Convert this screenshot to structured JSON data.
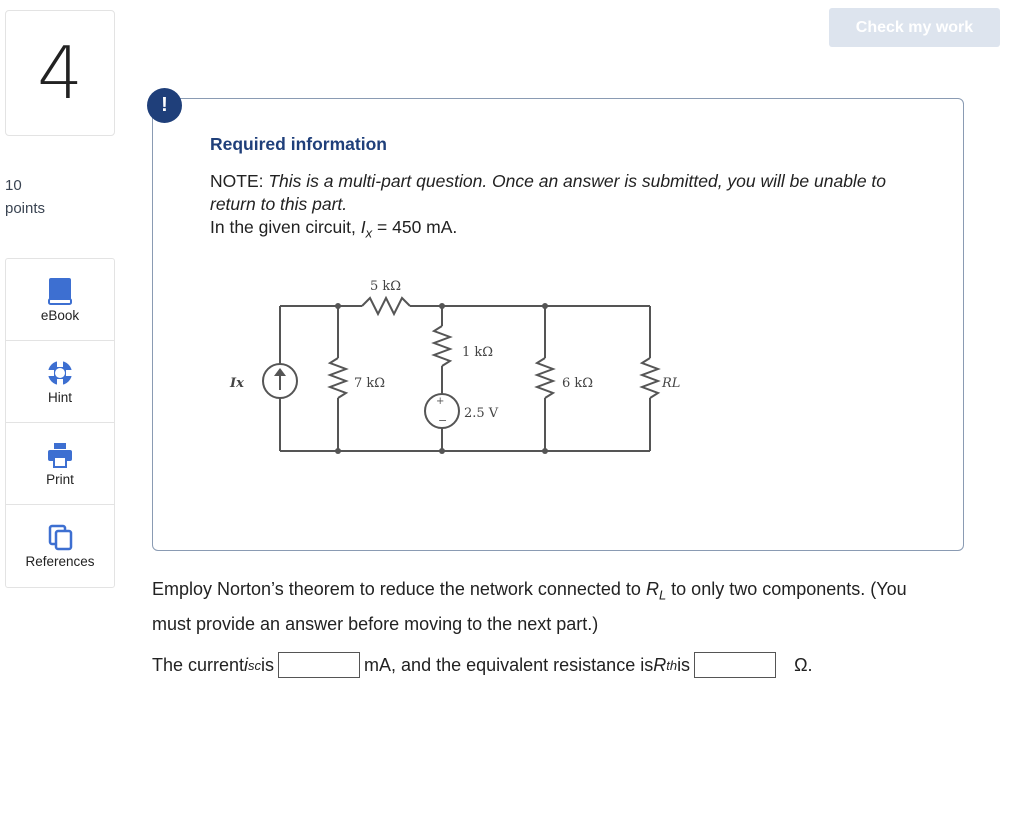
{
  "question": {
    "number": "4",
    "points_value": "10",
    "points_label": "points"
  },
  "tools": [
    {
      "label": "eBook",
      "icon": "book-icon"
    },
    {
      "label": "Hint",
      "icon": "lifebuoy-icon"
    },
    {
      "label": "Print",
      "icon": "printer-icon"
    },
    {
      "label": "References",
      "icon": "copy-pages-icon"
    }
  ],
  "header": {
    "check_button": "Check my work"
  },
  "info": {
    "alert_symbol": "!",
    "title": "Required information",
    "note_prefix": "NOTE: ",
    "note_text": "This is a multi-part question. Once an answer is submitted, you will be unable to return to this part.",
    "given_prefix": "In the given circuit, ",
    "given_var": "I",
    "given_sub": "x",
    "given_suffix": " = 450 mA."
  },
  "circuit": {
    "labels": {
      "ix": "Ix",
      "r5k": "5 kΩ",
      "r7k": "7 kΩ",
      "r1k": "1 kΩ",
      "v25": "2.5 V",
      "r6k": "6 kΩ",
      "rl": "RL"
    }
  },
  "prompt": {
    "text_1": "Employ Norton’s theorem to reduce the network connected to ",
    "var": "R",
    "sub": "L",
    "text_2": " to only two components. (You must provide an answer before moving to the next part.)"
  },
  "answer": {
    "part_1": "The current ",
    "isc_var": "i",
    "isc_sub": "sc",
    "part_2": " is",
    "part_3": "mA, and the equivalent resistance is ",
    "rth_var": "R",
    "rth_sub": "th",
    "part_4": " is",
    "unit_end": "Ω.",
    "isc_value": "",
    "rth_value": ""
  },
  "colors": {
    "accent": "#1f3f7a",
    "tool_icon": "#3d6fd1",
    "button_disabled": "#dde4ee"
  }
}
